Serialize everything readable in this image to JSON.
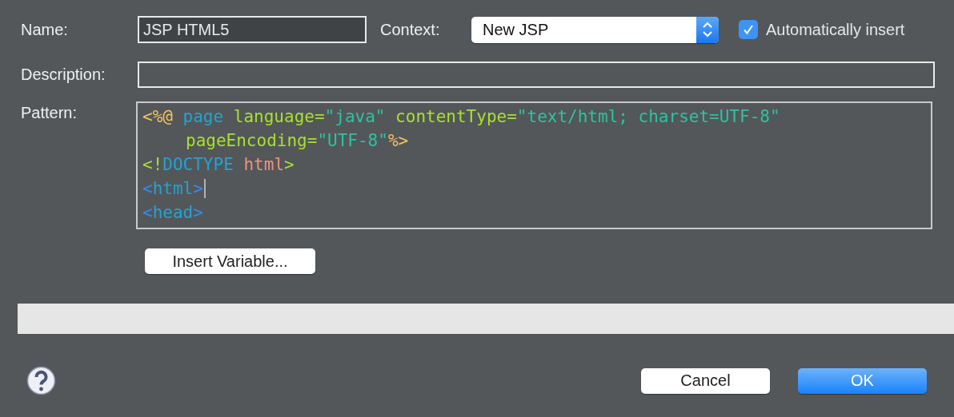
{
  "form": {
    "name_label": "Name:",
    "name_value": "JSP HTML5",
    "context_label": "Context:",
    "context_value": "New JSP",
    "auto_insert": {
      "label": "Automatically insert",
      "checked": true
    },
    "description_label": "Description:",
    "pattern_label": "Pattern:"
  },
  "pattern": [
    {
      "caret": false,
      "indent": false,
      "tokens": [
        {
          "text": "<%@",
          "color": "#f5c45a"
        },
        {
          "text": " page",
          "color": "#22a3d6"
        },
        {
          "text": " language",
          "color": "#a8e02c"
        },
        {
          "text": "=",
          "color": "#a8e02c"
        },
        {
          "text": "\"java\"",
          "color": "#2cc3a1"
        },
        {
          "text": " contentType",
          "color": "#a8e02c"
        },
        {
          "text": "=",
          "color": "#a8e02c"
        },
        {
          "text": "\"text/html; charset=UTF-8\"",
          "color": "#2cc3a1"
        }
      ]
    },
    {
      "caret": false,
      "indent": true,
      "tokens": [
        {
          "text": "pageEncoding",
          "color": "#a8e02c"
        },
        {
          "text": "=",
          "color": "#a8e02c"
        },
        {
          "text": "\"UTF-8\"",
          "color": "#2cc3a1"
        },
        {
          "text": "%>",
          "color": "#f5c45a"
        }
      ]
    },
    {
      "caret": false,
      "indent": false,
      "tokens": [
        {
          "text": "<!",
          "color": "#a8e02c"
        },
        {
          "text": "DOCTYPE",
          "color": "#22a3d6"
        },
        {
          "text": " html",
          "color": "#f3907e"
        },
        {
          "text": ">",
          "color": "#a8e02c"
        }
      ]
    },
    {
      "caret": true,
      "indent": false,
      "tokens": [
        {
          "text": "<",
          "color": "#2f8cf3"
        },
        {
          "text": "html",
          "color": "#22a3d6"
        },
        {
          "text": ">",
          "color": "#2f8cf3"
        }
      ]
    },
    {
      "caret": false,
      "indent": false,
      "tokens": [
        {
          "text": "<",
          "color": "#2f8cf3"
        },
        {
          "text": "head",
          "color": "#22a3d6"
        },
        {
          "text": ">",
          "color": "#2f8cf3"
        }
      ]
    }
  ],
  "insert_variable_button": "Insert Variable...",
  "buttons": [
    {
      "label": "Cancel",
      "kind": "secondary"
    },
    {
      "label": "OK",
      "kind": "default"
    }
  ]
}
